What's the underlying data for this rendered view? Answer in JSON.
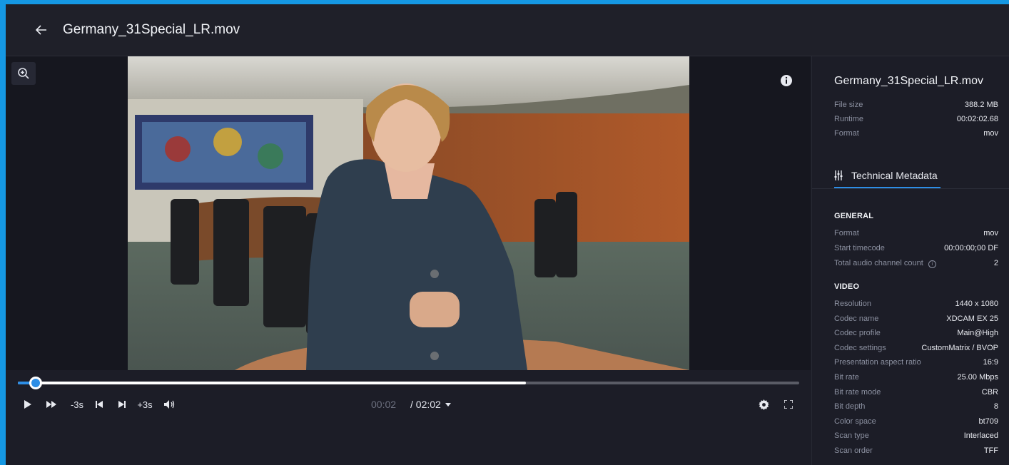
{
  "header": {
    "title": "Germany_31Special_LR.mov"
  },
  "player": {
    "progress_fraction": 0.65,
    "played_fraction": 0.02,
    "controls": {
      "rewind_label": "-3s",
      "forward_label": "+3s"
    },
    "time_current": "00:02",
    "time_total": "/ 02:02"
  },
  "sidebar": {
    "title": "Germany_31Special_LR.mov",
    "summary": [
      {
        "key": "File size",
        "value": "388.2 MB"
      },
      {
        "key": "Runtime",
        "value": "00:02:02.68"
      },
      {
        "key": "Format",
        "value": "mov"
      }
    ],
    "tab_label": "Technical Metadata",
    "general_heading": "GENERAL",
    "general": [
      {
        "key": "Format",
        "value": "mov"
      },
      {
        "key": "Start timecode",
        "value": "00:00:00;00 DF"
      },
      {
        "key": "Total audio channel count",
        "value": "2"
      }
    ],
    "video_heading": "VIDEO",
    "video": [
      {
        "key": "Resolution",
        "value": "1440 x 1080"
      },
      {
        "key": "Codec name",
        "value": "XDCAM EX 25"
      },
      {
        "key": "Codec profile",
        "value": "Main@High"
      },
      {
        "key": "Codec settings",
        "value": "CustomMatrix / BVOP"
      },
      {
        "key": "Presentation aspect ratio",
        "value": "16:9"
      },
      {
        "key": "Bit rate",
        "value": "25.00 Mbps"
      },
      {
        "key": "Bit rate mode",
        "value": "CBR"
      },
      {
        "key": "Bit depth",
        "value": "8"
      },
      {
        "key": "Color space",
        "value": "bt709"
      },
      {
        "key": "Scan type",
        "value": "Interlaced"
      },
      {
        "key": "Scan order",
        "value": "TFF"
      }
    ]
  },
  "colors": {
    "accent": "#2d8ee6",
    "border": "#1598e3",
    "background": "#1c1d27"
  }
}
